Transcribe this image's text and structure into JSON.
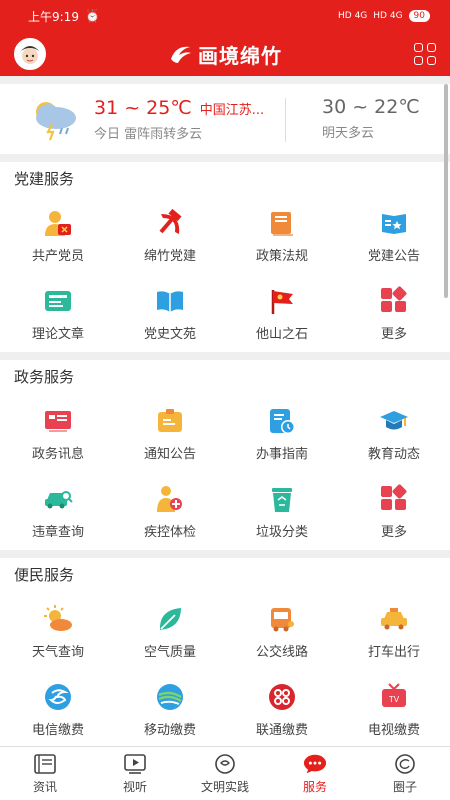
{
  "status": {
    "time": "上午9:19",
    "net1": "HD 4G",
    "net2": "HD 4G",
    "battery": "90"
  },
  "header": {
    "title": "画境绵竹"
  },
  "weather": {
    "today_temp": "31 ~ 25℃",
    "location": "中国江苏...",
    "today_desc": "今日 雷阵雨转多云",
    "tomorrow_temp": "30 ~ 22℃",
    "tomorrow_desc": "明天多云"
  },
  "party": {
    "title": "党建服务",
    "items": [
      {
        "label": "共产党员"
      },
      {
        "label": "绵竹党建"
      },
      {
        "label": "政策法规"
      },
      {
        "label": "党建公告"
      },
      {
        "label": "理论文章"
      },
      {
        "label": "党史文苑"
      },
      {
        "label": "他山之石"
      },
      {
        "label": "更多"
      }
    ]
  },
  "gov": {
    "title": "政务服务",
    "items": [
      {
        "label": "政务讯息"
      },
      {
        "label": "通知公告"
      },
      {
        "label": "办事指南"
      },
      {
        "label": "教育动态"
      },
      {
        "label": "违章查询"
      },
      {
        "label": "疾控体检"
      },
      {
        "label": "垃圾分类"
      },
      {
        "label": "更多"
      }
    ]
  },
  "civil": {
    "title": "便民服务",
    "items": [
      {
        "label": "天气查询"
      },
      {
        "label": "空气质量"
      },
      {
        "label": "公交线路"
      },
      {
        "label": "打车出行"
      },
      {
        "label": "电信缴费"
      },
      {
        "label": "移动缴费"
      },
      {
        "label": "联通缴费"
      },
      {
        "label": "电视缴费"
      }
    ]
  },
  "tabs": [
    {
      "label": "资讯"
    },
    {
      "label": "视听"
    },
    {
      "label": "文明实践"
    },
    {
      "label": "服务"
    },
    {
      "label": "圈子"
    }
  ],
  "colors": {
    "brand": "#e3201c"
  }
}
